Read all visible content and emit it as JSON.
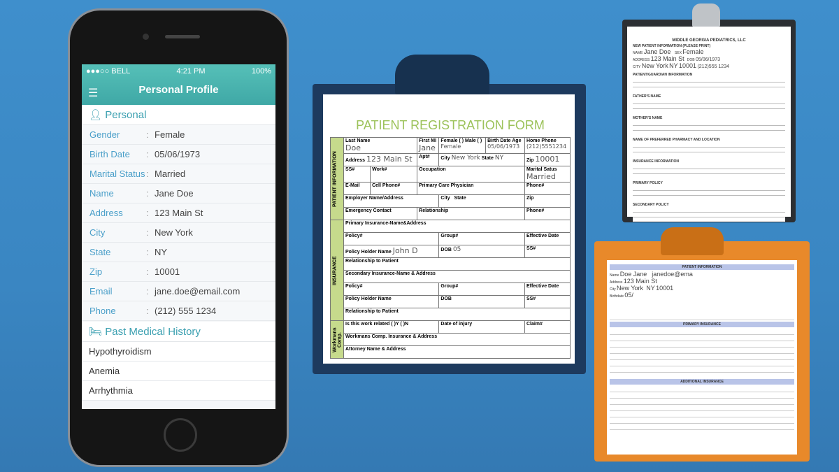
{
  "phone": {
    "status": {
      "carrier": "●●●○○ BELL",
      "time": "4:21 PM",
      "battery": "100%"
    },
    "header": {
      "title": "Personal Profile",
      "menu_icon": "hamburger-icon"
    },
    "personal": {
      "title": "Personal",
      "fields": [
        {
          "label": "Gender",
          "value": "Female"
        },
        {
          "label": "Birth Date",
          "value": "05/06/1973"
        },
        {
          "label": "Marital Status",
          "value": "Married"
        },
        {
          "label": "Name",
          "value": "Jane Doe"
        },
        {
          "label": "Address",
          "value": "123 Main St"
        },
        {
          "label": "City",
          "value": "New York"
        },
        {
          "label": "State",
          "value": "NY"
        },
        {
          "label": "Zip",
          "value": "10001"
        },
        {
          "label": "Email",
          "value": "jane.doe@email.com"
        },
        {
          "label": "Phone",
          "value": "(212) 555 1234"
        }
      ]
    },
    "history": {
      "title": "Past Medical History",
      "items": [
        "Hypothyroidism",
        "Anemia",
        "Arrhythmia"
      ]
    },
    "colors": {
      "header": "#4db6b0",
      "accent": "#4a9fc9"
    }
  },
  "form": {
    "title": "PATIENT REGISTRATION FORM",
    "sections": {
      "patient": "PATIENT INFORMATION",
      "insurance": "INSURANCE",
      "workmans": "Workmans Comp."
    },
    "labels": {
      "last_name": "Last Name",
      "first": "First",
      "mi": "MI",
      "sex": "Female ( ) Male ( )",
      "birth_date": "Birth Date",
      "age": "Age",
      "home_phone": "Home Phone",
      "address": "Address",
      "apt": "Apt#",
      "city": "City",
      "state": "State",
      "zip": "Zip",
      "ss": "SS#",
      "work": "Work#",
      "occupation": "Occupation",
      "marital": "Marital Satus",
      "email": "E-Mail",
      "cell": "Cell Phone#",
      "pcp": "Primary Care Physician",
      "phone": "Phone#",
      "employer": "Employer Name/Address",
      "emergency": "Emergency Contact",
      "relationship": "Relationship",
      "primary_ins": "Primary Insurance-Name&Address",
      "policy": "Policy#",
      "group": "Group#",
      "effective": "Effective Date",
      "holder": "Policy Holder Name",
      "dob": "DOB",
      "rel_patient": "Relationship to Patient",
      "secondary_ins": "Secondary Insurance-Name & Address",
      "work_related": "Is this work related ( )Y ( )N",
      "date_injury": "Date of injury",
      "claim": "Claim#",
      "wc_ins": "Workmans Comp. Insurance & Address",
      "attorney": "Attorney Name & Address"
    },
    "values": {
      "last_name": "Doe",
      "first": "Jane",
      "sex": "Female",
      "birth_date": "05/06/1973",
      "home_phone": "(212)5551234",
      "address": "123 Main St",
      "city": "New York",
      "state": "NY",
      "zip": "10001",
      "marital": "Married",
      "holder": "John D",
      "dob": "05"
    }
  },
  "clipboard2": {
    "title": "MIDDLE GEORGIA PEDIATRICS, LLC",
    "subtitle": "NEW PATIENT INFORMATION (PLEASE PRINT)",
    "name": "Jane Doe",
    "sex": "Female",
    "address": "123 Main St",
    "city": "New York",
    "state": "NY",
    "zip": "10001",
    "dob": "05/06/1973",
    "phone": "(212)555 1234",
    "sections": [
      "PATIENT/GUARDIAN INFORMATION",
      "FATHER'S NAME",
      "MOTHER'S NAME",
      "NAME OF PREFERRED PHARMACY AND LOCATION",
      "INSURANCE INFORMATION",
      "PRIMARY POLICY",
      "SECONDARY POLICY"
    ]
  },
  "clipboard3": {
    "sections": [
      "PATIENT INFORMATION",
      "PRIMARY INSURANCE",
      "ADDITIONAL INSURANCE"
    ],
    "name": "Doe Jane",
    "address": "123 Main St",
    "city": "New York",
    "state": "NY",
    "zip": "10001",
    "email": "janedoe@ema",
    "dob": "05/"
  }
}
